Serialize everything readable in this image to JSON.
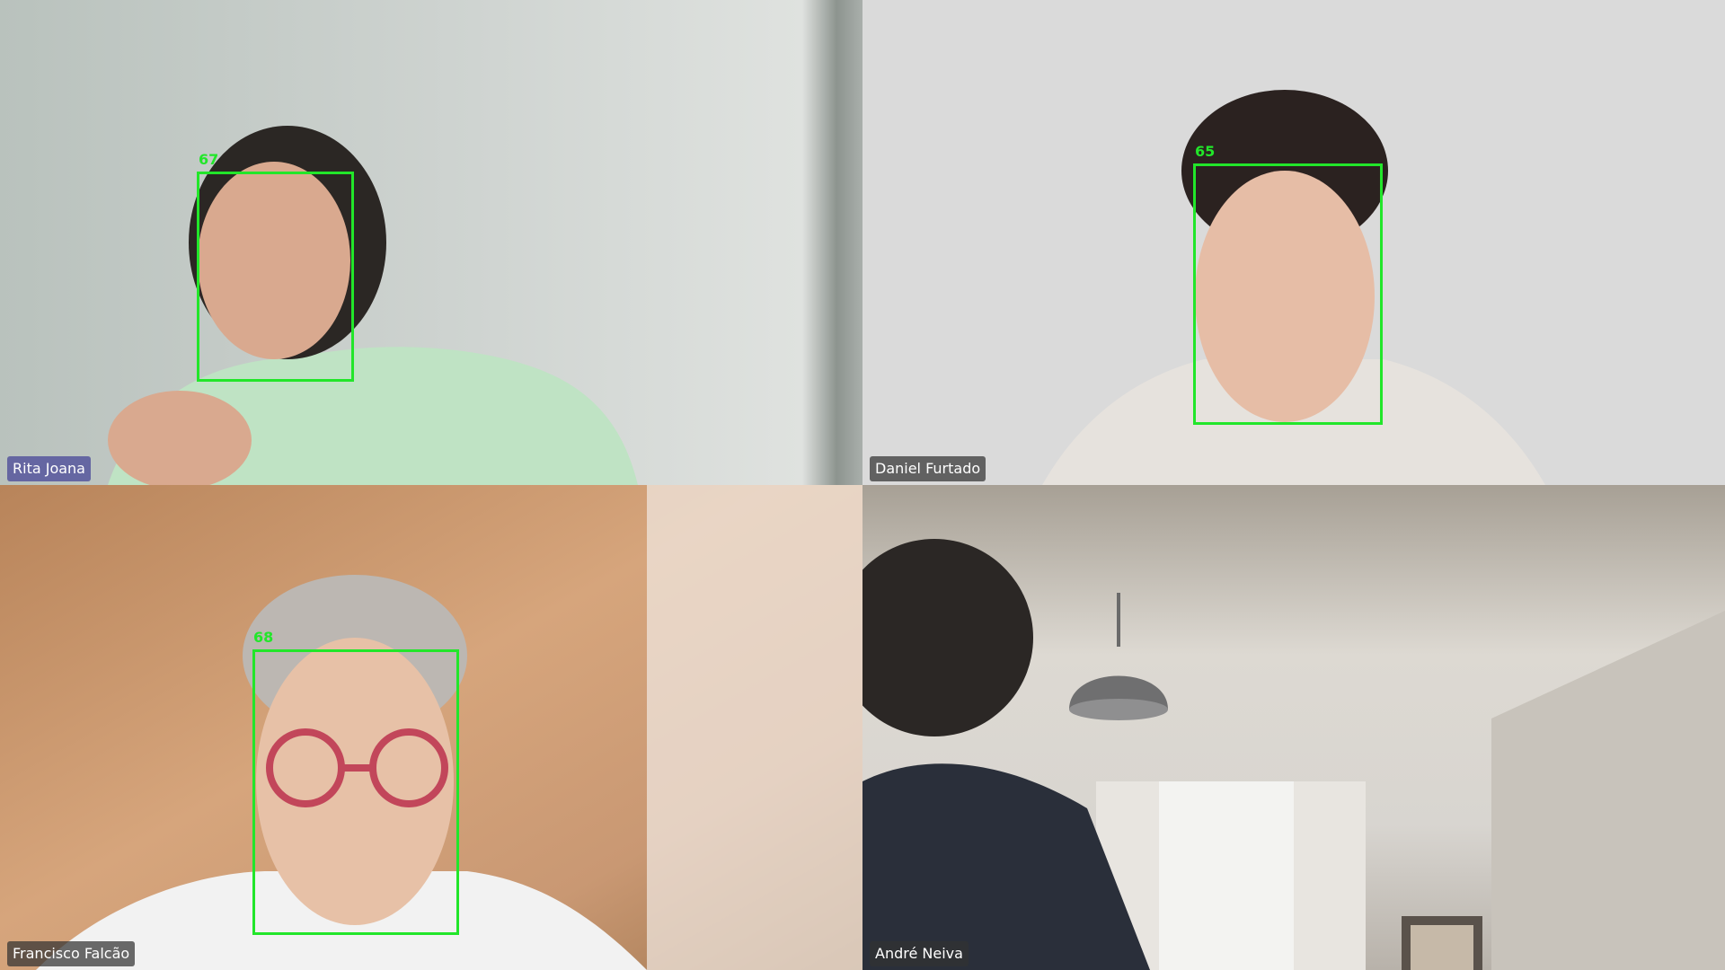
{
  "app": {
    "layout": "gallery-2x2"
  },
  "participants": [
    {
      "name": "Rita Joana",
      "active_speaker": true,
      "face_id": "67",
      "has_face_box": true,
      "tag_color": "#5a5aa0"
    },
    {
      "name": "Daniel Furtado",
      "active_speaker": false,
      "face_id": "65",
      "has_face_box": true,
      "tag_color": "#3c3c3c"
    },
    {
      "name": "Francisco Falcão",
      "active_speaker": false,
      "face_id": "68",
      "has_face_box": true,
      "tag_color": "#3c3c3c"
    },
    {
      "name": "André Neiva",
      "active_speaker": false,
      "face_id": "",
      "has_face_box": false,
      "tag_color": "#3c3c3c"
    }
  ],
  "colors": {
    "face_box": "#22e62a",
    "name_tag_text": "#ffffff"
  }
}
